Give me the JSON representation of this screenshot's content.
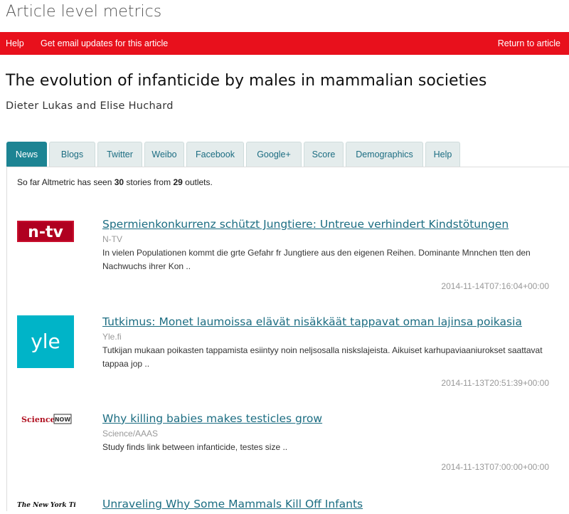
{
  "header": {
    "app_title": "Article level metrics"
  },
  "toolbar": {
    "help": "Help",
    "email_updates": "Get email updates for this article",
    "return": "Return to article"
  },
  "article": {
    "title": "The evolution of infanticide by males in mammalian societies",
    "authors": "Dieter Lukas and Elise Huchard"
  },
  "tabs": [
    {
      "label": "News"
    },
    {
      "label": "Blogs"
    },
    {
      "label": "Twitter"
    },
    {
      "label": "Weibo"
    },
    {
      "label": "Facebook"
    },
    {
      "label": "Google+"
    },
    {
      "label": "Score"
    },
    {
      "label": "Demographics"
    },
    {
      "label": "Help"
    }
  ],
  "active_tab": "News",
  "summary": {
    "prefix": "So far Altmetric has seen ",
    "stories": "30",
    "middle": " stories from ",
    "outlets": "29",
    "suffix": " outlets."
  },
  "news": [
    {
      "logo_text": "n-tv",
      "headline": "Spermienkonkurrenz schützt Jungtiere: Untreue verhindert Kindstötungen",
      "source": "N-TV",
      "snippet": "In vielen Populationen kommt die grte Gefahr fr Jungtiere aus den eigenen Reihen. Dominante Mnnchen tten den Nachwuchs ihrer Kon ..",
      "timestamp": "2014-11-14T07:16:04+00:00"
    },
    {
      "logo_text": "yle",
      "headline": "Tutkimus: Monet laumoissa elävät nisäkkäät tappavat oman lajinsa poikasia",
      "source": "Yle.fi",
      "snippet": "Tutkijan mukaan poikasten tappamista esiintyy noin neljsosalla niskslajeista. Aikuiset karhupaviaaniurokset saattavat tappaa jop ..",
      "timestamp": "2014-11-13T20:51:39+00:00"
    },
    {
      "logo_text": "Science",
      "logo_text2": "NOW",
      "headline": "Why killing babies makes testicles grow",
      "source": "Science/AAAS",
      "snippet": "Study finds link between infanticide, testes size ..",
      "timestamp": "2014-11-13T07:00:00+00:00"
    },
    {
      "logo_text": "The New York Times",
      "headline": "Unraveling Why Some Mammals Kill Off Infants"
    }
  ]
}
